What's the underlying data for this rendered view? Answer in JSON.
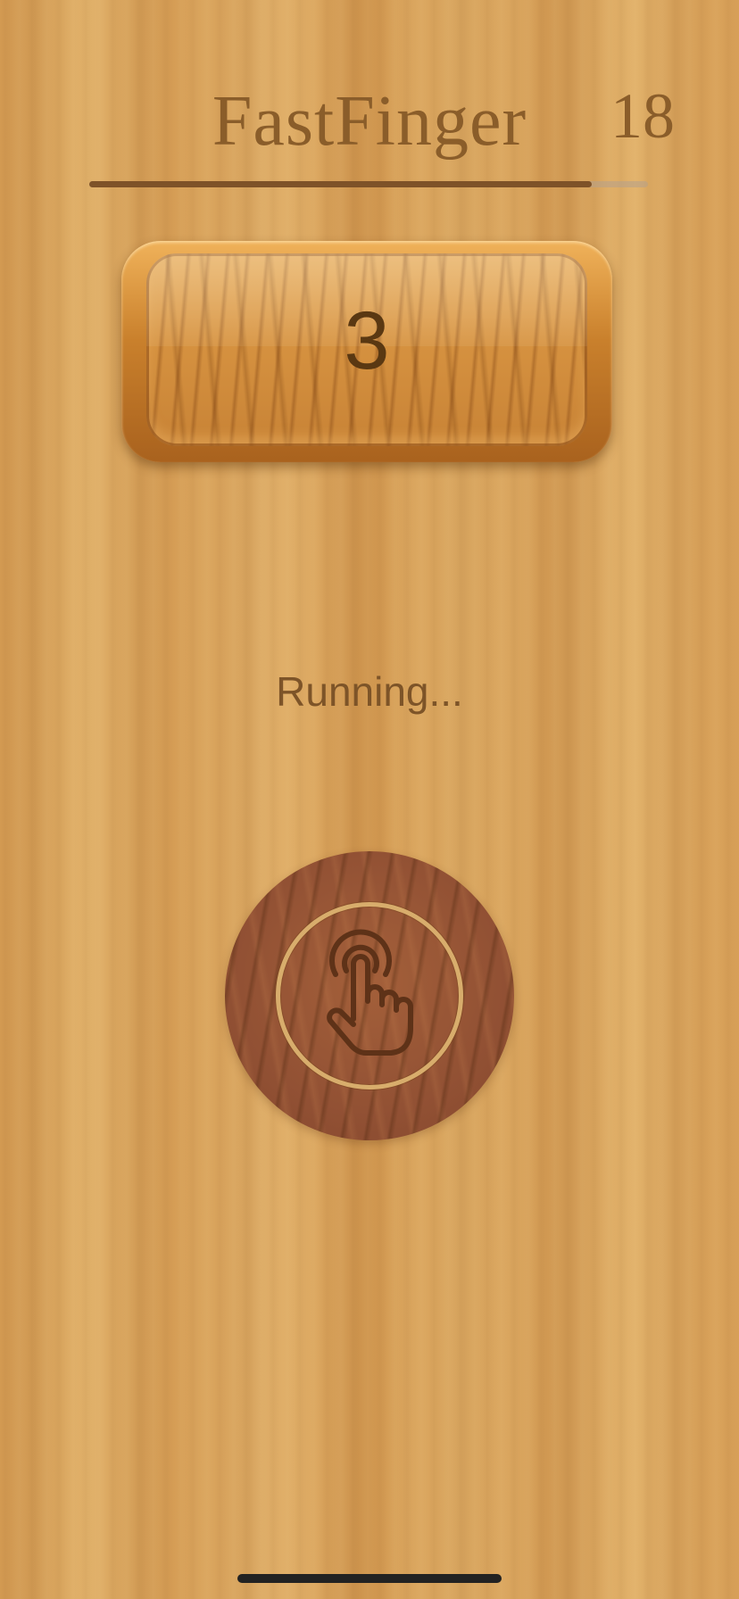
{
  "app": {
    "title": "FastFinger",
    "score": "18"
  },
  "timer": {
    "progress": 0.9
  },
  "counter": {
    "value": "3"
  },
  "status": {
    "text": "Running..."
  },
  "tap_button": {
    "icon": "tap-hand-icon"
  },
  "colors": {
    "text_brown": "#8a5d2a",
    "counter_text": "#5a3812",
    "button_wood": "#925134",
    "ring": "#d8ad6c",
    "progress_fill": "#7e5228"
  }
}
